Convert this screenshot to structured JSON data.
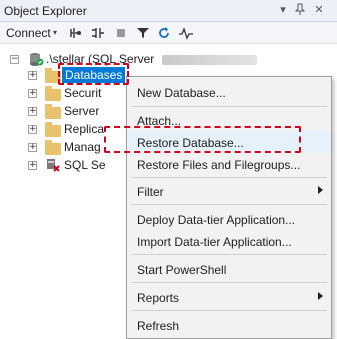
{
  "window": {
    "title": "Object Explorer",
    "pin_glyph": "⊣",
    "float_glyph": "▾",
    "close_glyph": "✕"
  },
  "toolbar": {
    "connect_label": "Connect",
    "caret_glyph": "▾"
  },
  "tree": {
    "server_label": ".\\stellar (SQL Server",
    "items": [
      {
        "label": "Databases",
        "selected": true
      },
      {
        "label": "Securit"
      },
      {
        "label": "Server"
      },
      {
        "label": "Replica"
      },
      {
        "label": "Manag"
      },
      {
        "label": "SQL Se"
      }
    ]
  },
  "context_menu": {
    "items": [
      {
        "label": "New Database..."
      },
      {
        "label": "Attach..."
      },
      {
        "label": "Restore Database...",
        "highlighted": true
      },
      {
        "label": "Restore Files and Filegroups..."
      },
      {
        "label": "Filter",
        "submenu": true
      },
      {
        "label": "Deploy Data-tier Application..."
      },
      {
        "label": "Import Data-tier Application..."
      },
      {
        "label": "Start PowerShell"
      },
      {
        "label": "Reports",
        "submenu": true
      },
      {
        "label": "Refresh"
      }
    ]
  },
  "colors": {
    "selection": "#0078d7",
    "annotation": "#d0021b",
    "folder": "#e8c26d"
  }
}
